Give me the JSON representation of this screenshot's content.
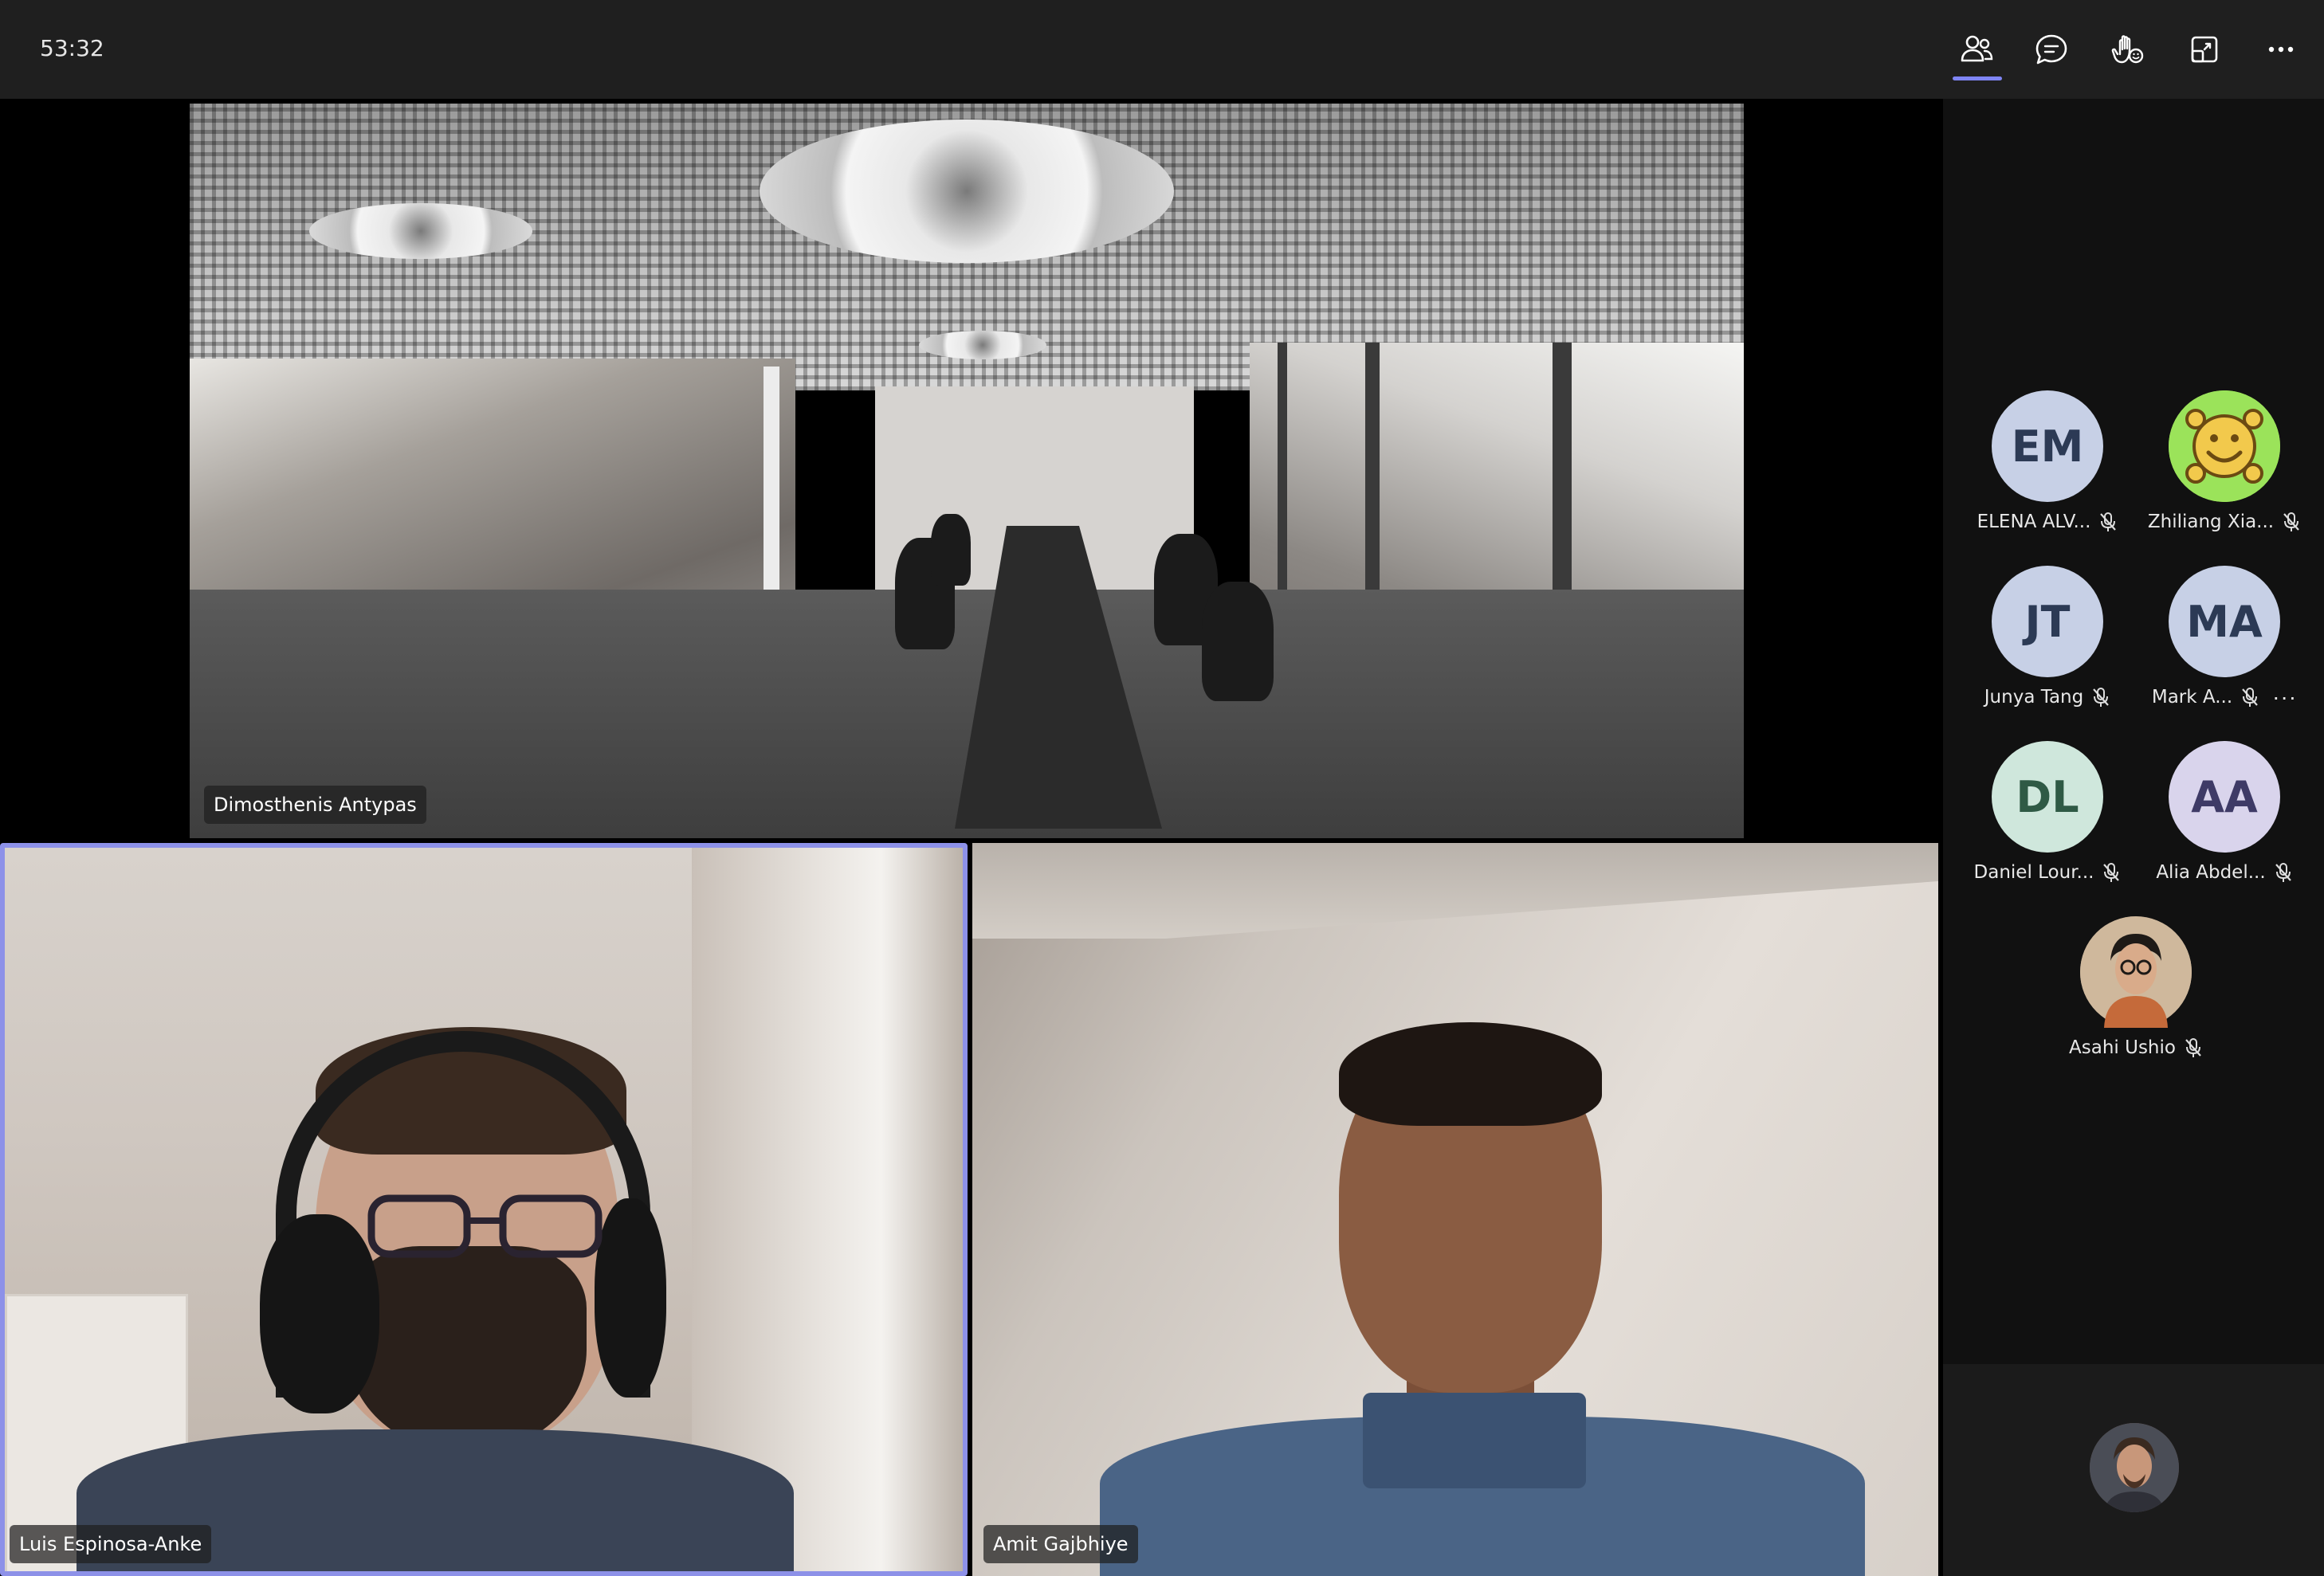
{
  "call": {
    "timer": "53:32"
  },
  "toolbar": {
    "icons": [
      "people-icon",
      "chat-icon",
      "raise-hand-icon",
      "share-tray-icon",
      "more-options-icon"
    ],
    "active_color": "#7f85f5"
  },
  "tiles": {
    "room": {
      "name": "Dimosthenis Antypas"
    },
    "luis": {
      "name": "Luis Espinosa-Anke",
      "highlight_color": "#8d91e8"
    },
    "amit": {
      "name": "Amit Gajbhiye"
    }
  },
  "participants": [
    {
      "initials": "EM",
      "name": "ELENA ALV...",
      "avatar_color": "#c7d0e6",
      "muted": true
    },
    {
      "initials": "",
      "name": "Zhiliang Xia...",
      "avatar_color": "#9be35a",
      "muted": true,
      "avatar_type": "smiley-icon"
    },
    {
      "initials": "JT",
      "name": "Junya Tang",
      "avatar_color": "#c7d0e6",
      "muted": true
    },
    {
      "initials": "MA",
      "name": "Mark A...",
      "avatar_color": "#c7d0e6",
      "muted": true,
      "more": "···"
    },
    {
      "initials": "DL",
      "name": "Daniel Lour...",
      "avatar_color": "#cfe7dc",
      "muted": true
    },
    {
      "initials": "AA",
      "name": "Alia Abdel...",
      "avatar_color": "#d9d4ec",
      "muted": true
    },
    {
      "initials": "",
      "name": "Asahi Ushio",
      "avatar_color": "#b08b6e",
      "muted": true,
      "avatar_type": "photo"
    }
  ]
}
